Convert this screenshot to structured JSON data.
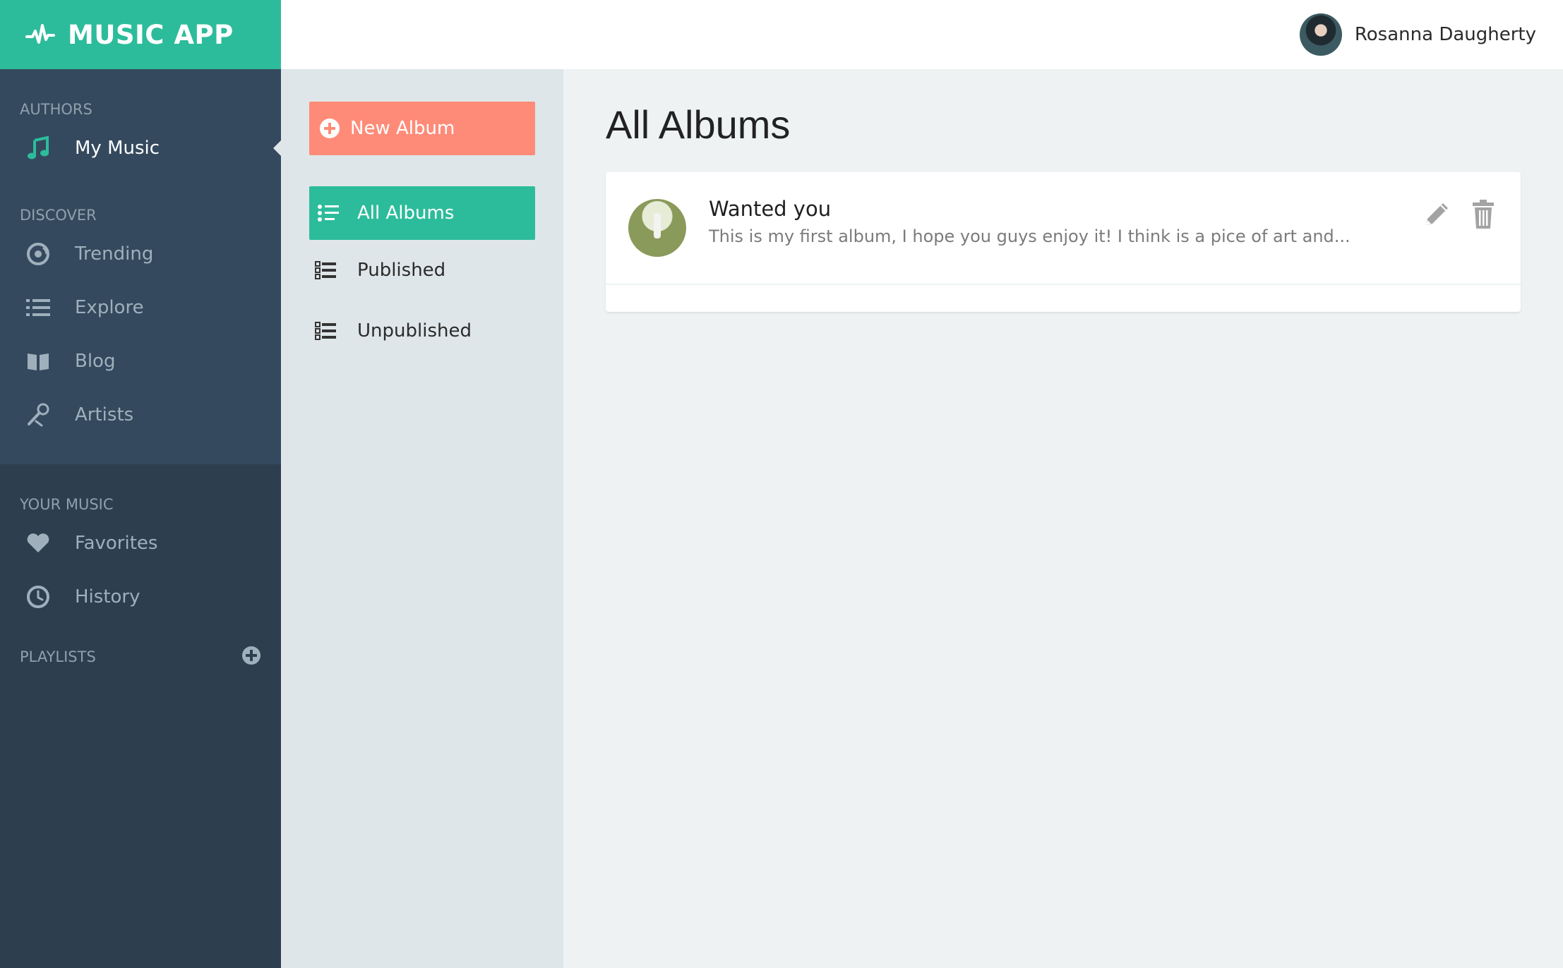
{
  "app": {
    "title": "MUSIC APP"
  },
  "user": {
    "name": "Rosanna Daugherty"
  },
  "sidebar": {
    "authors_label": "AUTHORS",
    "authors_items": [
      {
        "label": "My Music",
        "icon": "music-note-icon"
      }
    ],
    "discover_label": "DISCOVER",
    "discover_items": [
      {
        "label": "Trending",
        "icon": "disc-icon"
      },
      {
        "label": "Explore",
        "icon": "list-icon"
      },
      {
        "label": "Blog",
        "icon": "book-icon"
      },
      {
        "label": "Artists",
        "icon": "microphone-icon"
      }
    ],
    "your_music_label": "YOUR MUSIC",
    "your_music_items": [
      {
        "label": "Favorites",
        "icon": "heart-icon"
      },
      {
        "label": "History",
        "icon": "clock-icon"
      }
    ],
    "playlists_label": "PLAYLISTS"
  },
  "subnav": {
    "new_album_label": "New Album",
    "items": [
      {
        "label": "All Albums"
      },
      {
        "label": "Published"
      },
      {
        "label": "Unpublished"
      }
    ]
  },
  "main": {
    "title": "All Albums",
    "albums": [
      {
        "title": "Wanted you",
        "description": "This is my first album, I hope you guys enjoy it! I think is a pice of art and..."
      }
    ]
  },
  "colors": {
    "brand": "#2dbc9b",
    "accent_button": "#fe8b78",
    "sidebar_dark": "#2d3e4f",
    "sidebar_upper": "#34495e"
  }
}
